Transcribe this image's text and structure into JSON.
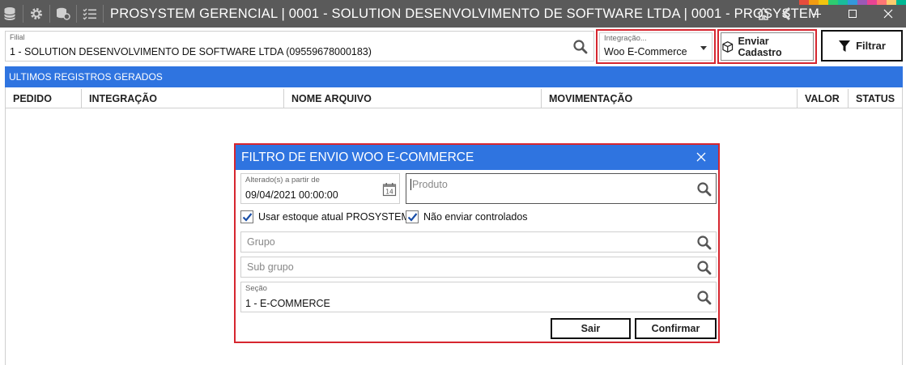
{
  "window": {
    "title": "PROSYSTEM GERENCIAL | 0001 - SOLUTION DESENVOLVIMENTO DE SOFTWARE LTDA | 0001 - PROSYSTEM",
    "stripe_colors": [
      "#e74c3c",
      "#f39c12",
      "#f1c40f",
      "#2ecc71",
      "#1abc9c",
      "#3498db",
      "#9b59b6",
      "#e84393",
      "#ff7675",
      "#fdcb6e",
      "#00b894"
    ]
  },
  "filters": {
    "filial_label": "Filial",
    "filial_value": "1 - SOLUTION DESENVOLVIMENTO DE SOFTWARE LTDA (09559678000183)",
    "integracao_label": "Integração...",
    "integracao_value": "Woo E-Commerce",
    "enviar_label": "Enviar Cadastro",
    "filtrar_label": "Filtrar"
  },
  "section": {
    "title": "ULTIMOS REGISTROS GERADOS"
  },
  "grid": {
    "columns": [
      "PEDIDO",
      "INTEGRAÇÃO",
      "NOME ARQUIVO",
      "MOVIMENTAÇÃO",
      "VALOR",
      "STATUS"
    ]
  },
  "modal": {
    "title": "FILTRO DE ENVIO WOO E-COMMERCE",
    "alterado_label": "Alterado(s) a partir de",
    "alterado_value": "09/04/2021 00:00:00",
    "produto_placeholder": "Produto",
    "usar_estoque_label": "Usar estoque atual PROSYSTEM",
    "usar_estoque_checked": true,
    "nao_enviar_label": "Não enviar controlados",
    "nao_enviar_checked": true,
    "grupo_placeholder": "Grupo",
    "subgrupo_placeholder": "Sub grupo",
    "secao_label": "Seção",
    "secao_value": "1 - E-COMMERCE",
    "sair_label": "Sair",
    "confirmar_label": "Confirmar"
  },
  "accent": "#2f74e0",
  "highlight": "#d6262f"
}
